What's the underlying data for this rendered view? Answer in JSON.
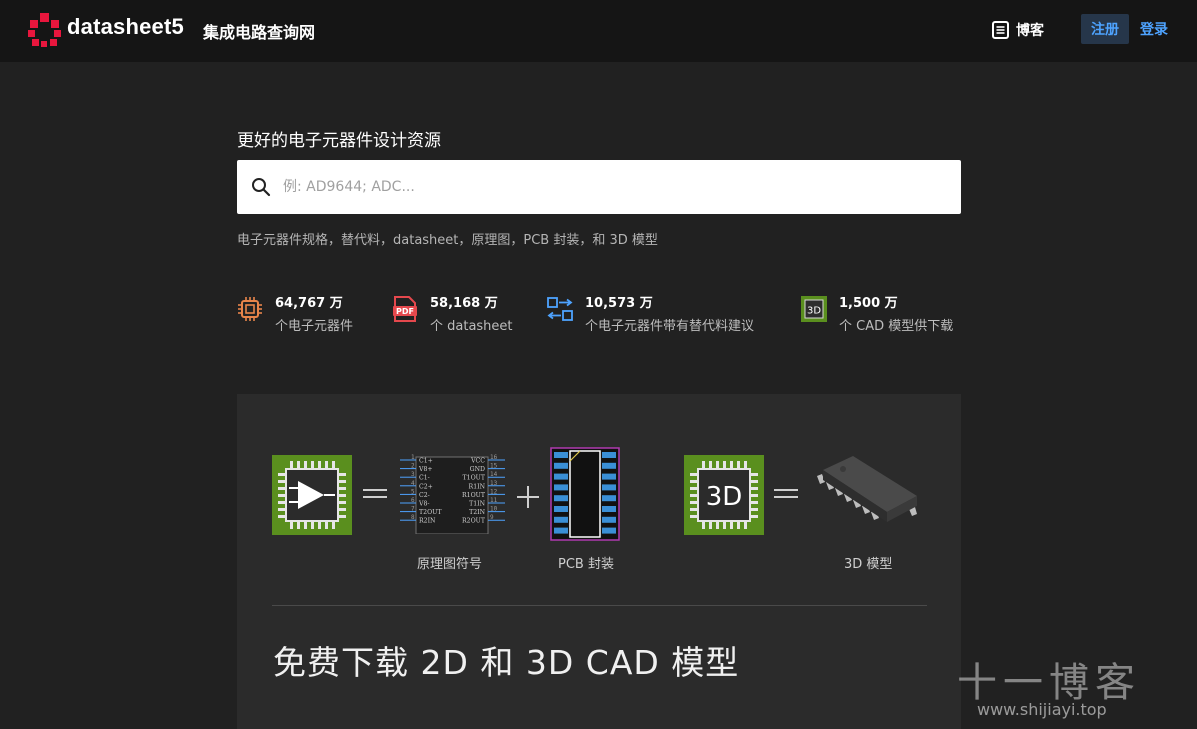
{
  "header": {
    "brand": "datasheet5",
    "subtitle": "集成电路查询网",
    "blog_label": "博客",
    "register_label": "注册",
    "login_label": "登录"
  },
  "hero": {
    "headline": "更好的电子元器件设计资源",
    "search_placeholder": "例: AD9644; ADC...",
    "tagline": "电子元器件规格，替代料，datasheet，原理图，PCB 封装，和 3D 模型"
  },
  "stats": [
    {
      "value": "64,767 万",
      "label": "个电子元器件",
      "icon": "chip-icon"
    },
    {
      "value": "58,168 万",
      "label": "个 datasheet",
      "icon": "pdf-icon"
    },
    {
      "value": "10,573 万",
      "label": "个电子元器件带有替代料建议",
      "icon": "swap-icon"
    },
    {
      "value": "1,500 万",
      "label": "个 CAD 模型供下载",
      "icon": "3d-chip-icon"
    }
  ],
  "panel": {
    "schematic_caption": "原理图符号",
    "pcb_caption": "PCB 封装",
    "model_caption": "3D 模型",
    "chip_3d_text": "3D",
    "left_pins": [
      "C1+",
      "V8+",
      "C1-",
      "C2+",
      "C2-",
      "V8-",
      "T2OUT",
      "R2IN"
    ],
    "right_pins": [
      "VCC",
      "GND",
      "T1OUT",
      "R1IN",
      "R1OUT",
      "T1IN",
      "T2IN",
      "R2OUT"
    ],
    "left_nums": [
      "1",
      "2",
      "3",
      "4",
      "5",
      "6",
      "7",
      "8"
    ],
    "right_nums": [
      "16",
      "15",
      "14",
      "13",
      "12",
      "11",
      "10",
      "9"
    ],
    "free_download": "免费下载 2D 和 3D CAD 模型"
  },
  "watermark": {
    "big": "十一博客",
    "small": "www.shijiayi.top"
  },
  "colors": {
    "accent_blue": "#4ea3ff",
    "chip_orange": "#e8854a",
    "pdf_red": "#e5484d",
    "chip_green": "#5a8f1e"
  }
}
